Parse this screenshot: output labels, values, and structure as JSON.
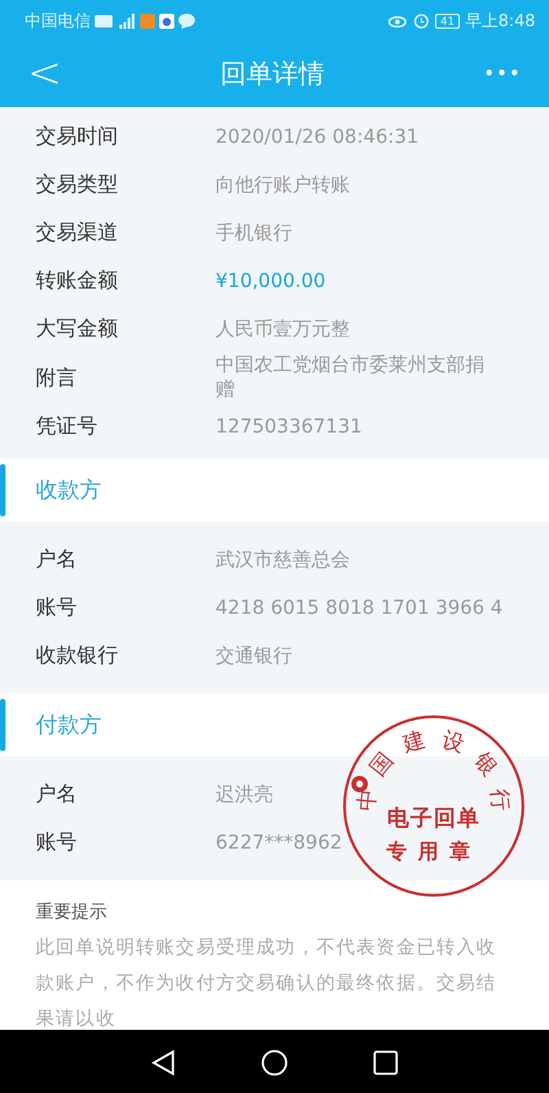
{
  "status_bar": {
    "carrier": "中国电信",
    "battery": "41",
    "time": "早上8:48"
  },
  "header": {
    "back": "<",
    "title": "回单详情",
    "more": "•••"
  },
  "details": [
    {
      "label": "交易时间",
      "value": "2020/01/26  08:46:31",
      "highlight": false
    },
    {
      "label": "交易类型",
      "value": "向他行账户转账",
      "highlight": false
    },
    {
      "label": "交易渠道",
      "value": "手机银行",
      "highlight": false
    },
    {
      "label": "转账金额",
      "value": "¥10,000.00",
      "highlight": true
    },
    {
      "label": "大写金额",
      "value": "人民币壹万元整",
      "highlight": false
    },
    {
      "label": "附言",
      "value": "中国农工党烟台市委莱州支部捐赠",
      "highlight": false
    },
    {
      "label": "凭证号",
      "value": "127503367131",
      "highlight": false
    }
  ],
  "sections": [
    {
      "title": "收款方",
      "rows": [
        {
          "label": "户名",
          "value": "武汉市慈善总会"
        },
        {
          "label": "账号",
          "value": "4218 6015 8018 1701 3966 4"
        },
        {
          "label": "收款银行",
          "value": "交通银行"
        }
      ]
    },
    {
      "title": "付款方",
      "rows": [
        {
          "label": "户名",
          "value": "迟洪亮"
        },
        {
          "label": "账号",
          "value": "6227***8962"
        }
      ]
    }
  ],
  "stamp": {
    "ring": "中国建设银行",
    "line_1": "电子回单",
    "line_2": "专用章"
  },
  "notice": {
    "title": "重要提示",
    "text": "此回单说明转账交易受理成功，不代表资金已转入收款账户，不作为收付方交易确认的最终依据。交易结果请以收"
  }
}
